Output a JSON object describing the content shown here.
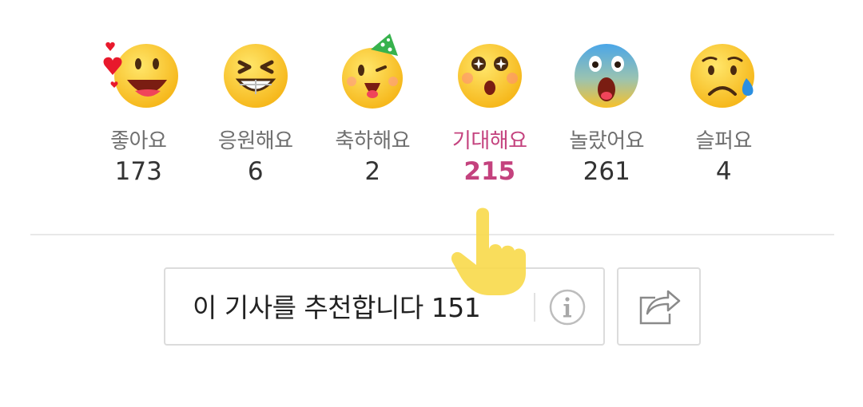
{
  "reactions": [
    {
      "label": "좋아요",
      "count": "173",
      "icon": "heart-eyes-emoji-icon"
    },
    {
      "label": "응원해요",
      "count": "6",
      "icon": "cheering-emoji-icon"
    },
    {
      "label": "축하해요",
      "count": "2",
      "icon": "party-hat-emoji-icon"
    },
    {
      "label": "기대해요",
      "count": "215",
      "icon": "sparkle-eyes-emoji-icon",
      "active": true
    },
    {
      "label": "놀랐어요",
      "count": "261",
      "icon": "shocked-emoji-icon"
    },
    {
      "label": "슬퍼요",
      "count": "4",
      "icon": "sad-tear-emoji-icon"
    }
  ],
  "recommend": {
    "label": "이 기사를 추천합니다 151"
  },
  "colors": {
    "active": "#c4427e",
    "emoji_yellow": "#ffd23a",
    "border": "#dcdcdc"
  }
}
